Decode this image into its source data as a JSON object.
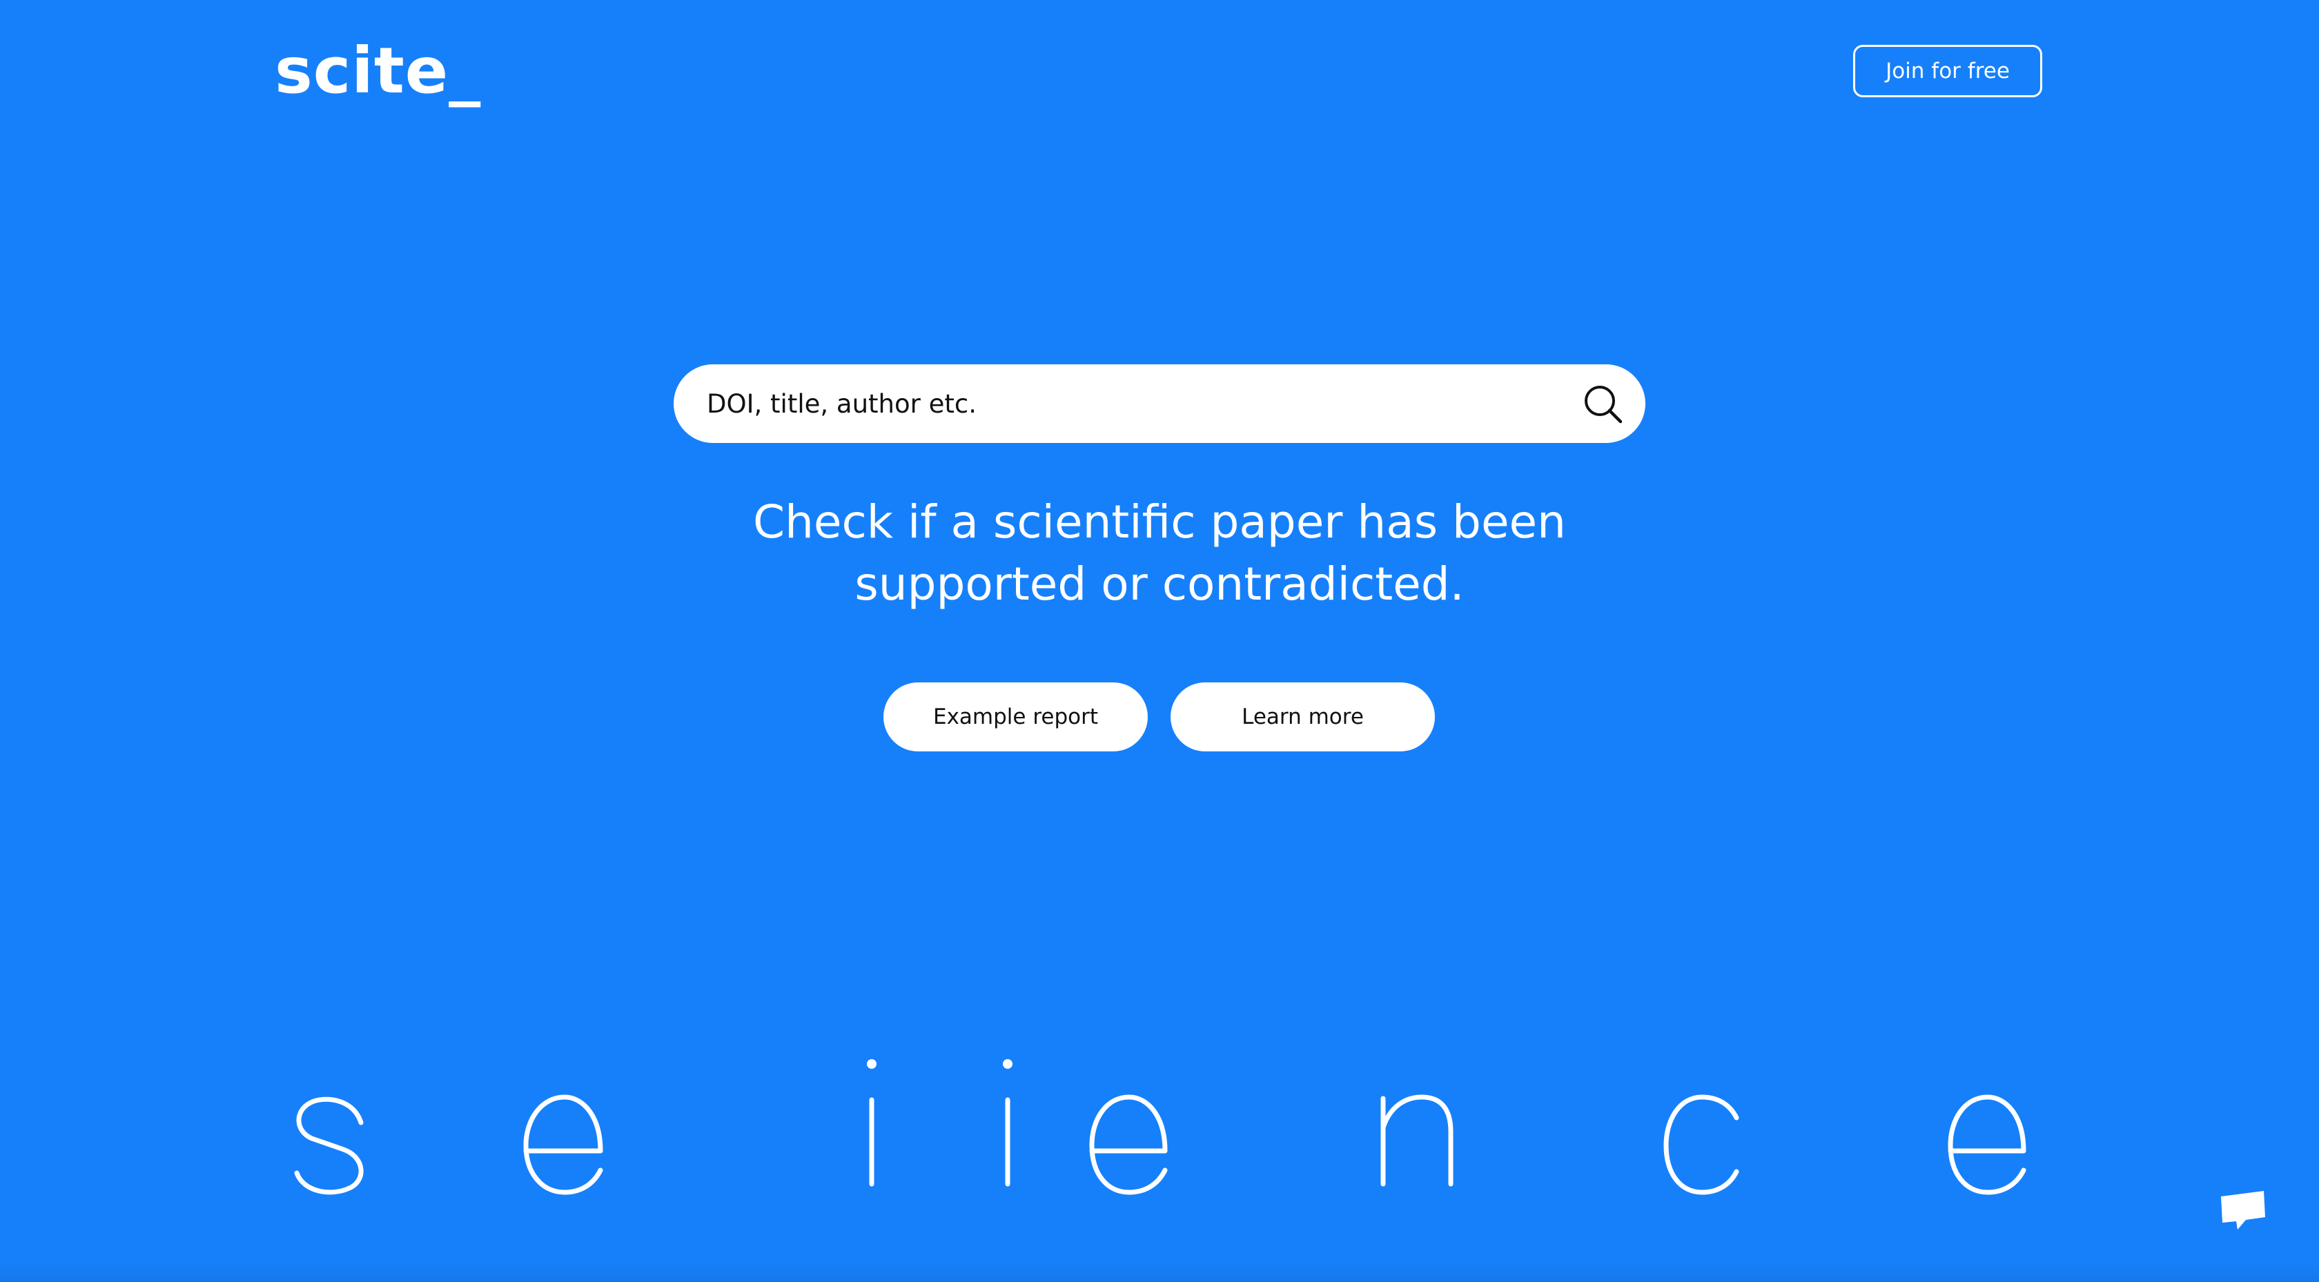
{
  "brand": {
    "logo_text": "scite_"
  },
  "header": {
    "join_label": "Join for free"
  },
  "search": {
    "placeholder": "DOI, title, author etc.",
    "icon": "search-icon"
  },
  "hero": {
    "tagline_line1": "Check if a scientific paper has been",
    "tagline_line2": "supported or contradicted."
  },
  "actions": {
    "example_label": "Example report",
    "learn_label": "Learn more"
  },
  "decor": {
    "letters": [
      "s",
      "e",
      "i",
      "i",
      "e",
      "n",
      "c",
      "e"
    ]
  },
  "chat": {
    "icon": "chat-bubble-icon"
  },
  "colors": {
    "background": "#1680fb",
    "text": "#ffffff",
    "button_bg": "#ffffff",
    "button_text": "#111111"
  }
}
